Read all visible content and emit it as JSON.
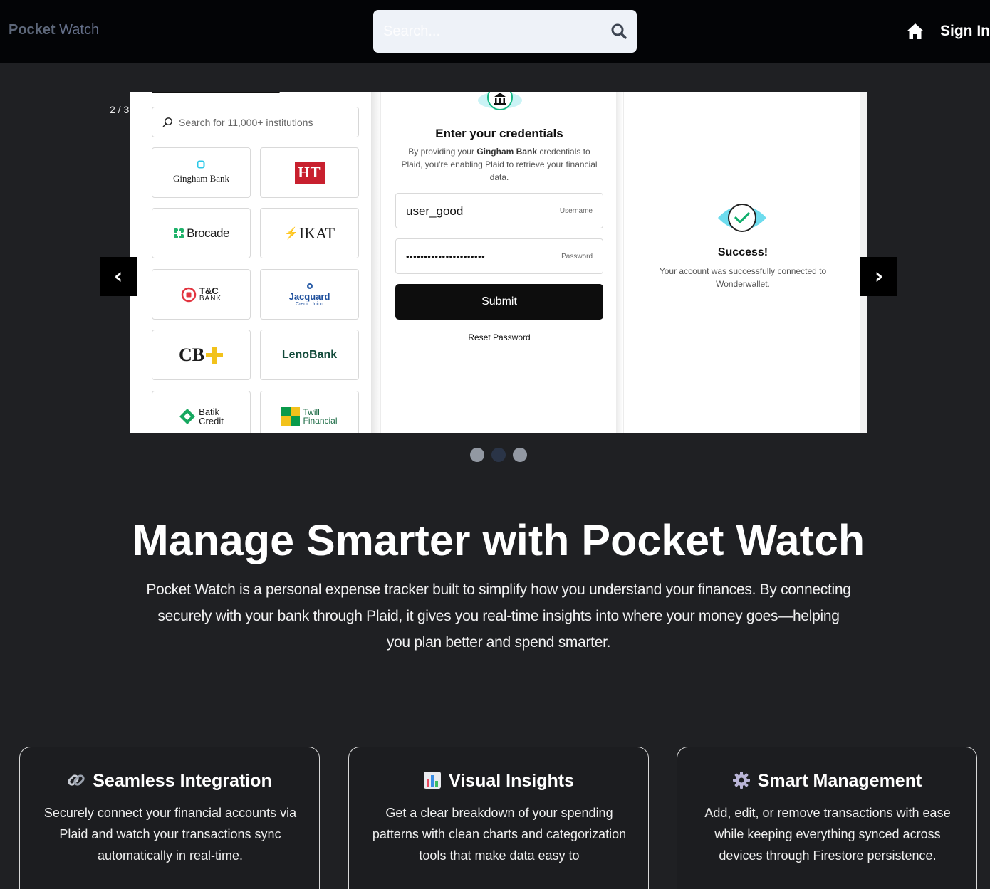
{
  "navbar": {
    "brand_part1": "Pocket",
    "brand_part2": "Watch",
    "search_placeholder": "Search...",
    "sign_in_label": "Sign In"
  },
  "carousel": {
    "counter": "2 / 3",
    "prev_arrow": "‹",
    "next_arrow": "›",
    "total_slides": 3,
    "active_slide": 2
  },
  "plaid_demo": {
    "institution_search_placeholder": "Search for 11,000+ institutions",
    "institutions": [
      {
        "name": "Gingham Bank"
      },
      {
        "name": "HT"
      },
      {
        "name": "Brocade"
      },
      {
        "name": "IKAT"
      },
      {
        "name": "T&C",
        "sub": "BANK"
      },
      {
        "name": "Jacquard",
        "sub": "Credit Union"
      },
      {
        "name": "CB"
      },
      {
        "name": "LenoBank"
      },
      {
        "name": "Batik",
        "sub": "Credit"
      },
      {
        "name": "Twill",
        "sub": "Financial"
      }
    ],
    "credentials": {
      "title": "Enter your credentials",
      "desc_pre": "By providing your ",
      "desc_bank": "Gingham Bank",
      "desc_post": " credentials to Plaid, you're enabling Plaid to retrieve your financial data.",
      "username_value": "user_good",
      "username_label": "Username",
      "password_value": "••••••••••••••••••••••",
      "password_label": "Password",
      "submit_label": "Submit",
      "reset_label": "Reset Password"
    },
    "success": {
      "title": "Success!",
      "desc": "Your account was successfully connected to Wonderwallet."
    }
  },
  "hero": {
    "title": "Manage Smarter with Pocket Watch",
    "description": "Pocket Watch is a personal expense tracker built to simplify how you understand your finances. By connecting securely with your bank through Plaid, it gives you real-time insights into where your money goes—helping you plan better and spend smarter."
  },
  "features": [
    {
      "icon": "link-icon",
      "title": "Seamless Integration",
      "description": "Securely connect your financial accounts via Plaid and watch your transactions sync automatically in real-time."
    },
    {
      "icon": "bar-chart-icon",
      "title": "Visual Insights",
      "description": "Get a clear breakdown of your spending patterns with clean charts and categorization tools that make data easy to"
    },
    {
      "icon": "gear-icon",
      "title": "Smart Management",
      "description": "Add, edit, or remove transactions with ease while keeping everything synced across devices through Firestore persistence."
    }
  ],
  "colors": {
    "page_bg": "#1f2023",
    "navbar_bg": "#030406",
    "search_bg": "#eef2f8",
    "dot_active": "#2a3447",
    "dot_inactive": "#9298a2"
  }
}
